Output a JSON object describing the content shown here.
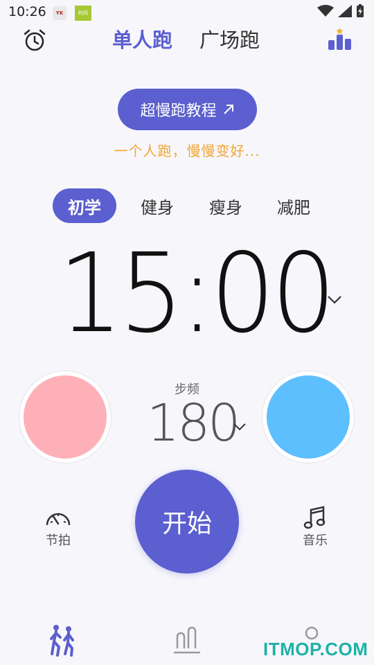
{
  "status_bar": {
    "time": "10:26",
    "notif_a": "YK",
    "notif_b": "时间"
  },
  "header": {
    "tab_solo": "单人跑",
    "tab_square": "广场跑"
  },
  "tutorial": {
    "label": "超慢跑教程",
    "slogan": "一个人跑，慢慢变好..."
  },
  "goals": [
    "初学",
    "健身",
    "瘦身",
    "减肥"
  ],
  "timer": {
    "value": "15:00"
  },
  "cadence": {
    "label": "步频",
    "value": "180"
  },
  "controls": {
    "start": "开始",
    "beat": "节拍",
    "music": "音乐"
  },
  "watermark": "ITMOP.COM",
  "colors": {
    "accent": "#5b5fcf",
    "slogan": "#f1a532",
    "left_circle": "#feb0b8",
    "right_circle": "#5ebfff"
  }
}
